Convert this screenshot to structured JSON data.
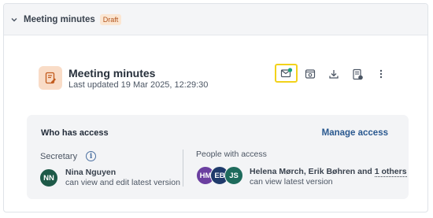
{
  "section": {
    "title": "Meeting minutes",
    "badge": "Draft"
  },
  "document": {
    "title": "Meeting minutes",
    "last_updated": "Last updated 19 Mar 2025, 12:29:30",
    "icon": "document-edit-icon"
  },
  "toolbar": {
    "buttons": [
      {
        "name": "send-email-icon",
        "active": true
      },
      {
        "name": "preview-icon",
        "active": false
      },
      {
        "name": "download-icon",
        "active": false
      },
      {
        "name": "export-pdf-icon",
        "active": false
      },
      {
        "name": "more-options-icon",
        "active": false
      }
    ],
    "active_outline_color": "#f2d21b"
  },
  "access": {
    "heading": "Who has access",
    "manage_label": "Manage access",
    "secretary": {
      "label": "Secretary",
      "initials": "NN",
      "avatar_color": "#1e5a48",
      "name": "Nina Nguyen",
      "permission": "can view and edit latest version"
    },
    "people": {
      "label": "People with access",
      "avatars": [
        {
          "initials": "HM",
          "color": "#6b3fa0"
        },
        {
          "initials": "EB",
          "color": "#1f3a6b"
        },
        {
          "initials": "JS",
          "color": "#1e6b5c"
        }
      ],
      "names": "Helena Mørch, Erik Bøhren and ",
      "others": "1 others",
      "permission": "can view latest version"
    }
  },
  "colors": {
    "accent_link": "#29588f",
    "badge_bg": "#fbe6d2",
    "badge_text": "#b2541d"
  }
}
